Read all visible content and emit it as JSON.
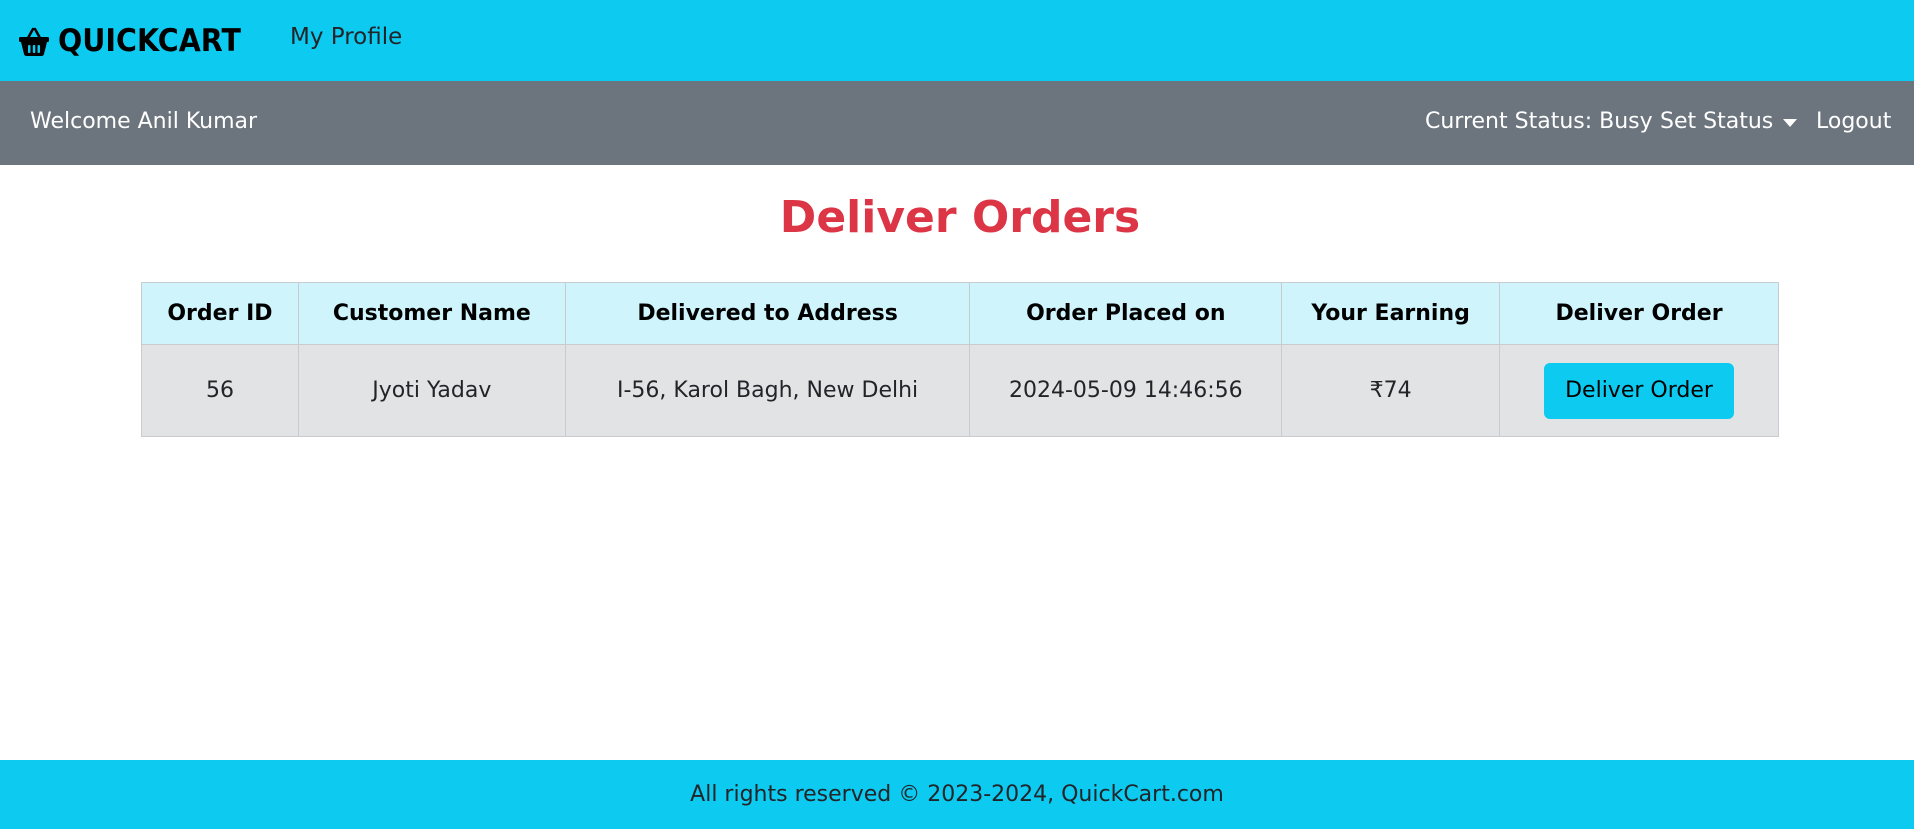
{
  "navbar": {
    "brand_name": "QUICKCART",
    "brand_icon": "basket-icon",
    "profile_link": "My Profile",
    "accent_color": "#0dcaf0"
  },
  "subbar": {
    "welcome_text": "Welcome Anil Kumar",
    "current_status": "Current Status: Busy",
    "set_status_label": "Set Status",
    "logout_label": "Logout",
    "background_color": "#6c757d"
  },
  "main": {
    "title": "Deliver Orders",
    "title_color": "#dc3545",
    "table": {
      "columns": [
        "Order ID",
        "Customer Name",
        "Delivered to Address",
        "Order Placed on",
        "Your Earning",
        "Deliver Order"
      ],
      "rows": [
        {
          "order_id": "56",
          "customer_name": "Jyoti Yadav",
          "address": "I-56, Karol Bagh, New Delhi",
          "placed_on": "2024-05-09 14:46:56",
          "earning": "₹74",
          "action_label": "Deliver Order"
        }
      ]
    }
  },
  "footer": {
    "text": "All rights reserved © 2023-2024, QuickCart.com"
  }
}
